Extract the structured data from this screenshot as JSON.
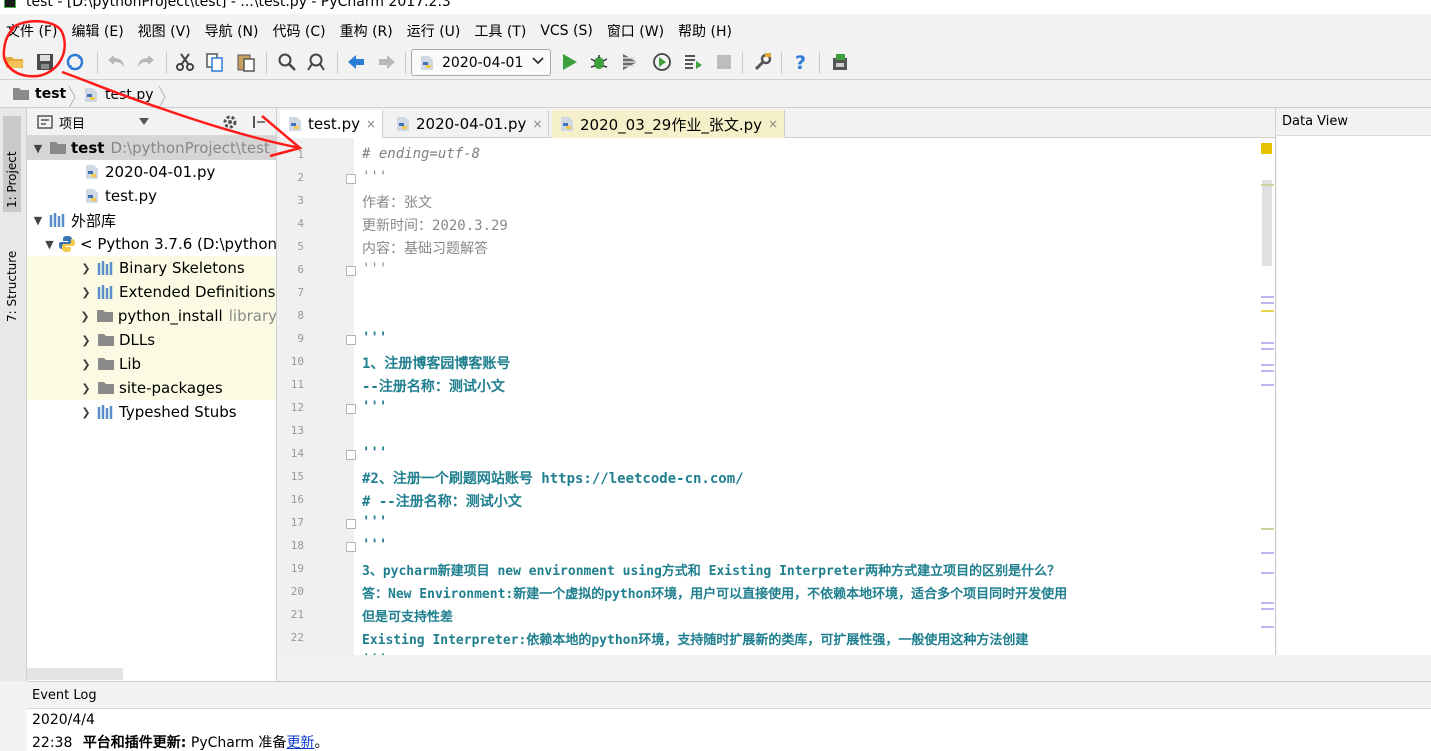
{
  "window": {
    "title": "test - [D:\\pythonProject\\test] - ...\\test.py - PyCharm 2017.2.3"
  },
  "menu": [
    "文件 (F)",
    "编辑 (E)",
    "视图 (V)",
    "导航 (N)",
    "代码 (C)",
    "重构 (R)",
    "运行 (U)",
    "工具 (T)",
    "VCS (S)",
    "窗口 (W)",
    "帮助 (H)"
  ],
  "toolbar": {
    "run_config": "2020-04-01"
  },
  "breadcrumb": [
    "test",
    "test.py"
  ],
  "sidebar_tabs": {
    "project": "1: Project",
    "structure": "7: Structure"
  },
  "project_panel": {
    "title": "项目",
    "tree": [
      {
        "label": "test",
        "detail": "D:\\pythonProject\\test"
      },
      {
        "label": "2020-04-01.py"
      },
      {
        "label": "test.py"
      },
      {
        "label": "外部库"
      },
      {
        "label": "< Python 3.7.6 (D:\\python"
      },
      {
        "label": "Binary Skeletons"
      },
      {
        "label": "Extended Definitions"
      },
      {
        "label": "python_install",
        "detail": "library"
      },
      {
        "label": "DLLs"
      },
      {
        "label": "Lib"
      },
      {
        "label": "site-packages"
      },
      {
        "label": "Typeshed Stubs"
      }
    ]
  },
  "editor": {
    "tabs": [
      {
        "label": "test.py",
        "close": "×"
      },
      {
        "label": "2020-04-01.py",
        "close": "×"
      },
      {
        "label": "2020_03_29作业_张文.py",
        "close": "×"
      }
    ],
    "line_numbers": [
      "1",
      "2",
      "3",
      "4",
      "5",
      "6",
      "7",
      "8",
      "9",
      "10",
      "11",
      "12",
      "13",
      "14",
      "15",
      "16",
      "17",
      "18",
      "19",
      "20",
      "21",
      "22"
    ],
    "lines": [
      "# ending=utf-8",
      "'''",
      "作者：张文",
      "更新时间：2020.3.29",
      "内容：基础习题解答",
      "'''",
      "",
      "",
      "'''",
      "1、注册博客园博客账号",
      "--注册名称：测试小文",
      "'''",
      "",
      "'''",
      "#2、注册一个刷题网站账号 https://leetcode-cn.com/",
      "# --注册名称：测试小文",
      "'''",
      "'''",
      "3、pycharm新建项目 new environment using方式和 Existing Interpreter两种方式建立项目的区别是什么？",
      "答：New Environment:新建一个虚拟的python环境，用户可以直接使用，不依赖本地环境，适合多个项目同时开发使用",
      "但是可支持性差",
      "Existing Interpreter:依赖本地的python环境，支持随时扩展新的类库，可扩展性强，一般使用这种方法创建",
      "'''"
    ]
  },
  "data_view": {
    "title": "Data View"
  },
  "event_log": {
    "title": "Event Log",
    "date": "2020/4/4",
    "time": "22:38",
    "bold_text": "平台和插件更新:",
    "message": " PyCharm 准备",
    "link": "更新",
    "suffix": "。"
  },
  "colors": {
    "accent_run": "#3ca03c",
    "docstring": "#1f7f8f",
    "link": "#0b39c8",
    "annotation": "#ff0000"
  }
}
